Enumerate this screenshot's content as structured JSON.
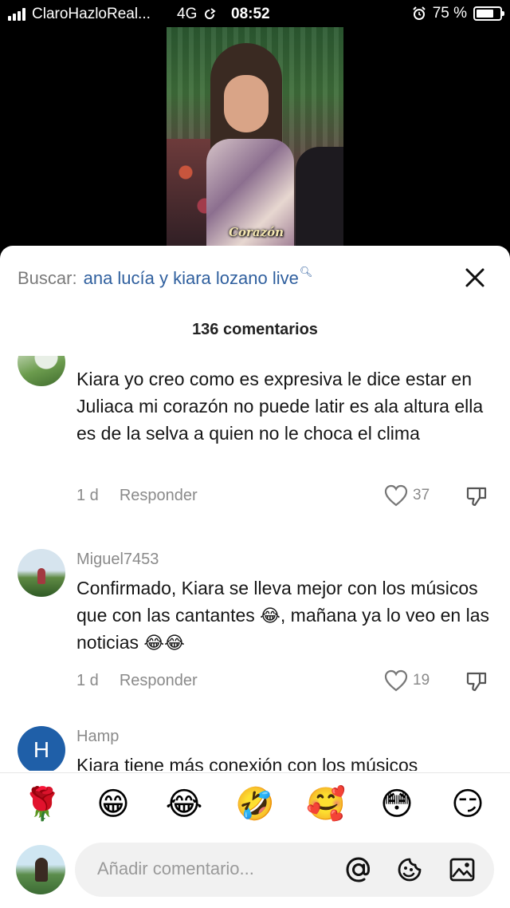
{
  "status_bar": {
    "carrier": "ClaroHazloReal...",
    "network": "4G",
    "time": "08:52",
    "battery": "75 %",
    "battery_level": 0.75
  },
  "video": {
    "caption": "Corazón"
  },
  "search": {
    "label": "Buscar:",
    "query": "ana lucía y kiara lozano live"
  },
  "comments_header": {
    "count_label": "136 comentarios"
  },
  "comments": [
    {
      "username": "",
      "text": "Kiara yo creo como es expresiva le dice estar en Juliaca mi corazón no puede latir es ala altura ella es de la selva a quien no le choca el clima",
      "age": "1 d",
      "reply": "Responder",
      "likes": "37"
    },
    {
      "username": "Miguel7453",
      "text_parts": [
        "Confirmado, Kiara se lleva mejor con los músicos que con las cantantes ",
        "😂",
        ", mañana ya lo veo en las noticias ",
        "😂😂"
      ],
      "age": "1 d",
      "reply": "Responder",
      "likes": "19"
    },
    {
      "username": "Hamp",
      "avatar_letter": "H",
      "text": "Kiara tiene más conexión con los músicos"
    }
  ],
  "emoji_bar": [
    "🌹",
    "😁",
    "😂",
    "🤣",
    "🥰",
    "😳",
    "😏"
  ],
  "input": {
    "placeholder": "Añadir comentario..."
  },
  "colors": {
    "accent_link": "#2f5f9e",
    "avatar_h": "#1f5fa8"
  }
}
